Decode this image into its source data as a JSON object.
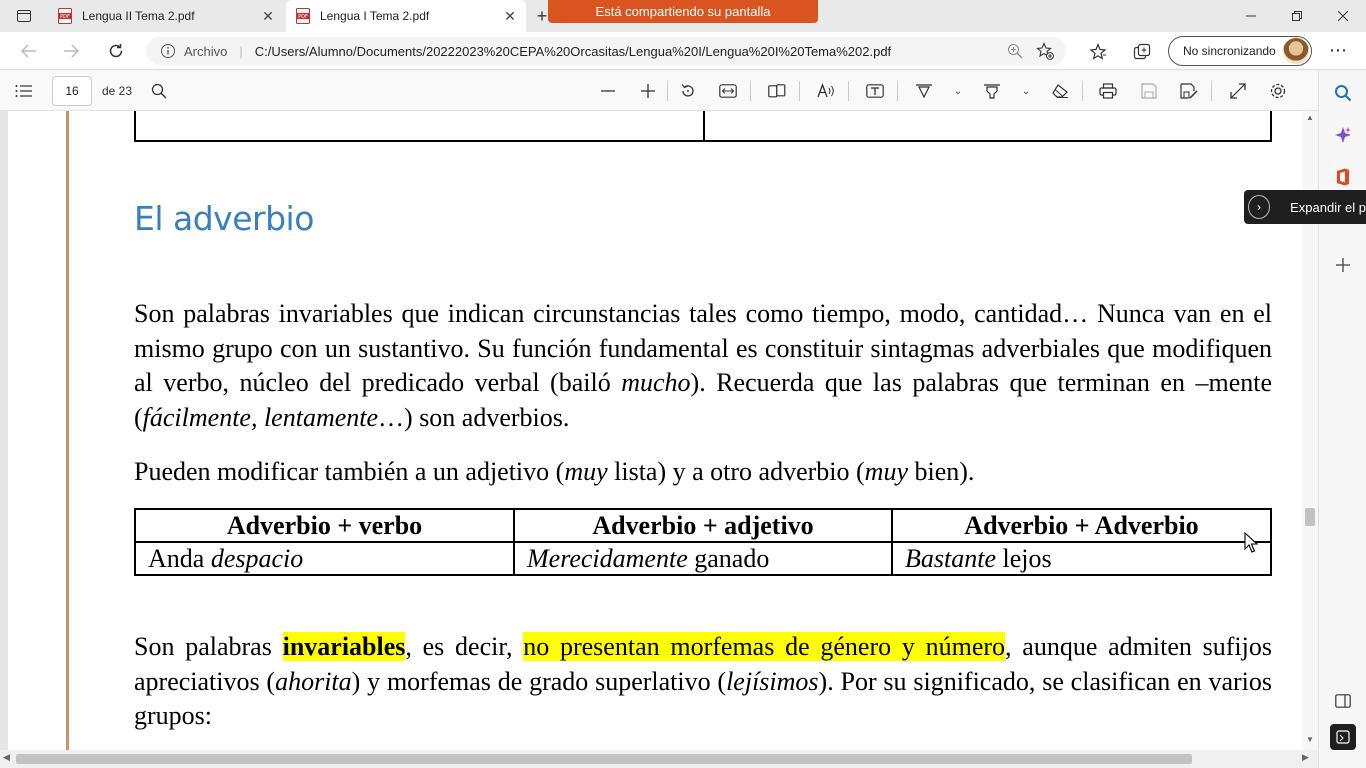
{
  "browser": {
    "tabs": [
      {
        "title": "Lengua II Tema 2.pdf",
        "active": false
      },
      {
        "title": "Lengua I Tema 2.pdf",
        "active": true
      }
    ],
    "share_banner": "Está compartiendo su pantalla",
    "address": {
      "scheme_label": "Archivo",
      "url": "C:/Users/Alumno/Documents/20222023%20CEPA%20Orcasitas/Lengua%20I/Lengua%20I%20Tema%202.pdf"
    },
    "sync_label": "No sincronizando"
  },
  "pdf_toolbar": {
    "page_number": "16",
    "page_of": "de 23"
  },
  "document": {
    "section_title": "El adverbio",
    "para1": {
      "t1": "Son palabras invariables que indican circunstancias tales como tiempo, modo, cantidad… Nunca van en el mismo grupo con un sustantivo. Su función fundamental es constituir sintagmas adverbiales que modifiquen al verbo, núcleo del predicado verbal (bailó ",
      "i1": "mucho",
      "t2": "). Recuerda que las palabras que terminan en –mente (",
      "i2": "fácilmente, lentamente",
      "t3": "…) son adverbios."
    },
    "para2": {
      "t1": "Pueden modificar también a un adjetivo (",
      "i1": "muy",
      "t2": " lista) y a otro adverbio (",
      "i2": "muy",
      "t3": " bien)."
    },
    "table": {
      "headers": [
        "Adverbio + verbo",
        "Adverbio + adjetivo",
        "Adverbio + Adverbio"
      ],
      "row": [
        {
          "plain_before": "Anda ",
          "italic": "despacio",
          "plain_after": ""
        },
        {
          "plain_before": "",
          "italic": "Merecidamente",
          "plain_after": " ganado"
        },
        {
          "plain_before": "",
          "italic": "Bastante",
          "plain_after": " lejos"
        }
      ]
    },
    "para3": {
      "t1": "Son palabras ",
      "b1": "invariables",
      "t2": ", es decir, ",
      "h1": "no presentan morfemas de género y número",
      "t3": ", aunque admiten sufijos apreciativos (",
      "i1": "ahorita",
      "t4": ") y morfemas de grado superlativo (",
      "i2": "lejísimos",
      "t5": "). Por su significado, se clasifican en varios grupos:"
    }
  },
  "sidebar": {
    "expand_label": "Expandir el p"
  },
  "colors": {
    "title_blue": "#3a7ec2",
    "highlight": "#ffff00",
    "share_banner": "#d9541e",
    "page_rule": "#c8956a"
  },
  "icons": [
    "tab-actions-icon",
    "pdf-file-icon",
    "close-icon",
    "plus-icon",
    "minimize-icon",
    "restore-icon",
    "back-icon",
    "forward-icon",
    "refresh-icon",
    "info-icon",
    "zoom-icon",
    "favorite-add-icon",
    "favorites-icon",
    "collections-icon",
    "more-icon",
    "contents-icon",
    "search-icon",
    "zoom-out-icon",
    "zoom-in-icon",
    "rotate-icon",
    "fit-width-icon",
    "page-view-icon",
    "read-aloud-icon",
    "text-icon",
    "draw-icon",
    "highlight-icon",
    "eraser-icon",
    "print-icon",
    "save-icon",
    "save-as-icon",
    "fullscreen-icon",
    "settings-icon",
    "copilot-icon",
    "office-icon",
    "add-icon",
    "split-screen-icon",
    "feedback-icon",
    "chevron-right-icon",
    "mouse-cursor-icon"
  ]
}
